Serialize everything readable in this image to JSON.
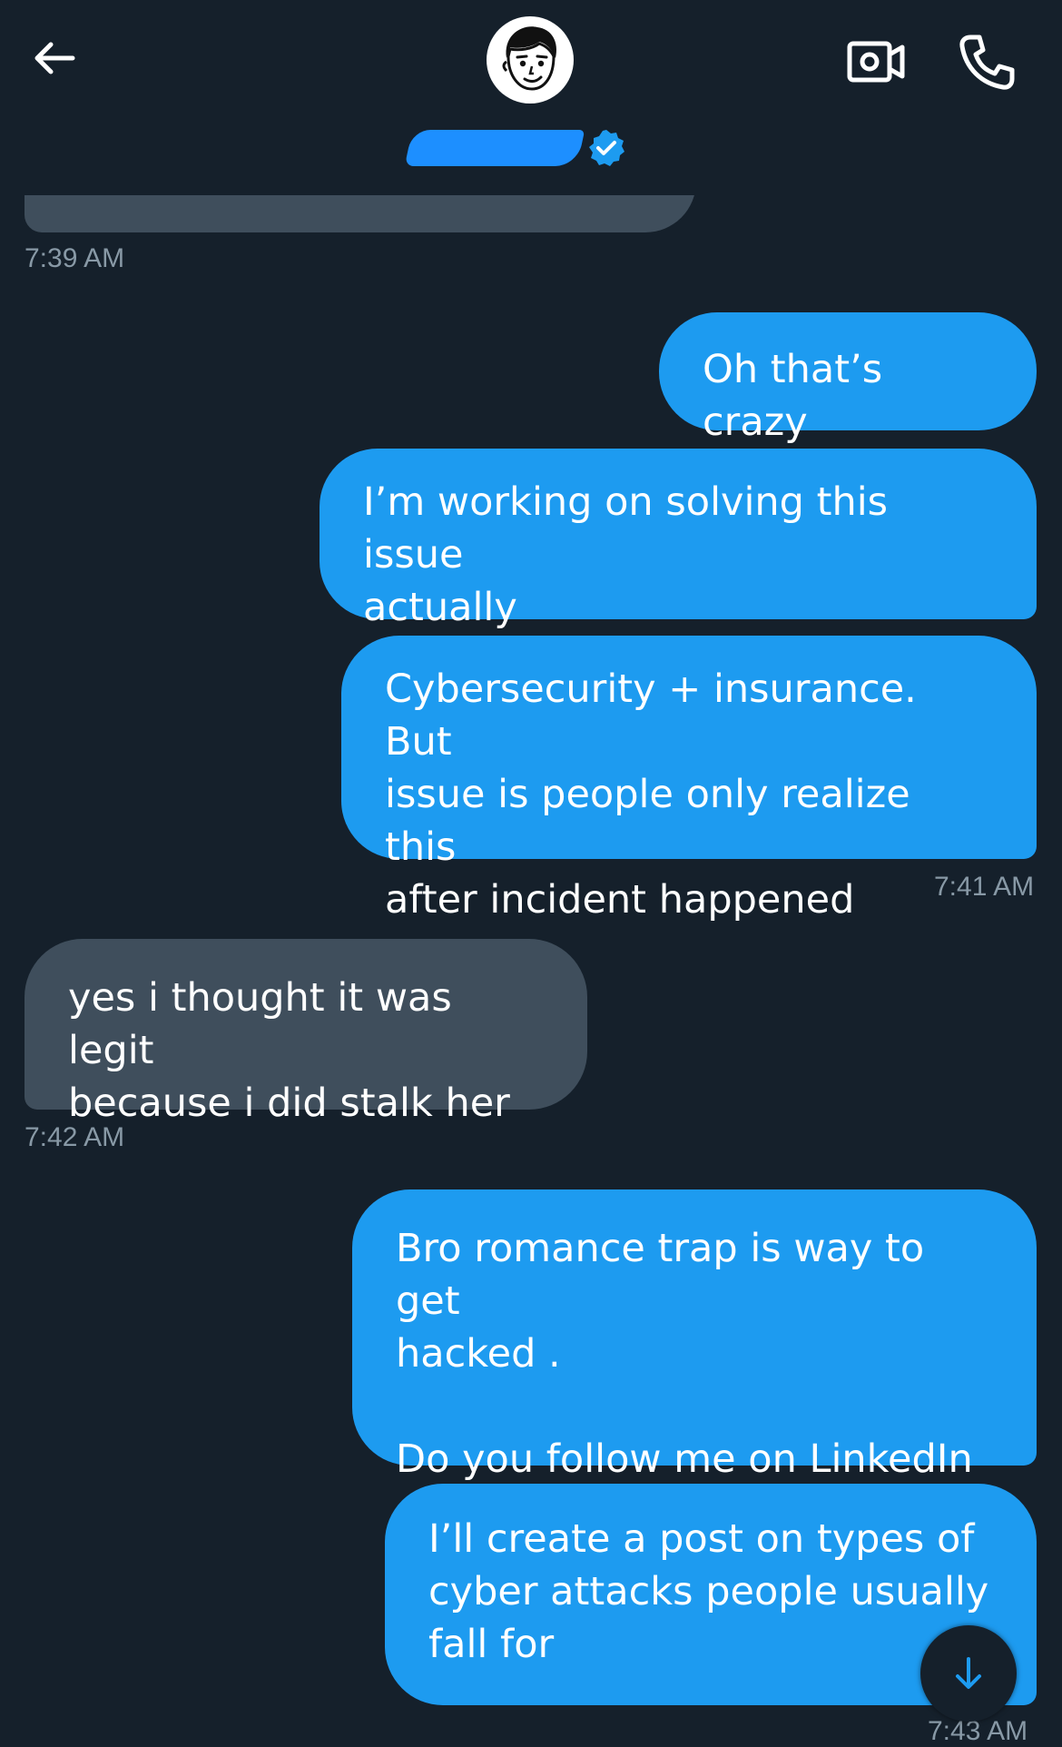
{
  "header": {
    "back_icon": "arrow-left-icon",
    "avatar_icon": "cartoon-face-avatar",
    "verified_icon": "verified-badge-icon",
    "video_icon": "video-camera-icon",
    "call_icon": "phone-icon"
  },
  "colors": {
    "background": "#15202b",
    "sent_bubble": "#1d9bf0",
    "received_bubble": "#3f4e5c",
    "timestamp": "#8899a6",
    "redaction": "#1d8fff"
  },
  "messages": [
    {
      "dir": "sent",
      "text": "Oh that’s crazy"
    },
    {
      "dir": "sent",
      "text": "I’m working on solving this issue\nactually"
    },
    {
      "dir": "sent",
      "text": "Cybersecurity + insurance. But\nissue is people only realize this\nafter incident happened"
    },
    {
      "dir": "received",
      "text": "yes i thought it was legit\nbecause i did stalk her"
    },
    {
      "dir": "sent",
      "text": "Bro romance trap is way to get\nhacked .\n\nDo you follow me on LinkedIn"
    },
    {
      "dir": "sent",
      "text": "I’ll create a post on types of\ncyber attacks people usually\nfall for"
    }
  ],
  "timestamps": {
    "t1": "7:39 AM",
    "t2": "7:41 AM",
    "t3": "7:42 AM",
    "t4": "7:43 AM"
  },
  "scroll_down_icon": "arrow-down-icon"
}
